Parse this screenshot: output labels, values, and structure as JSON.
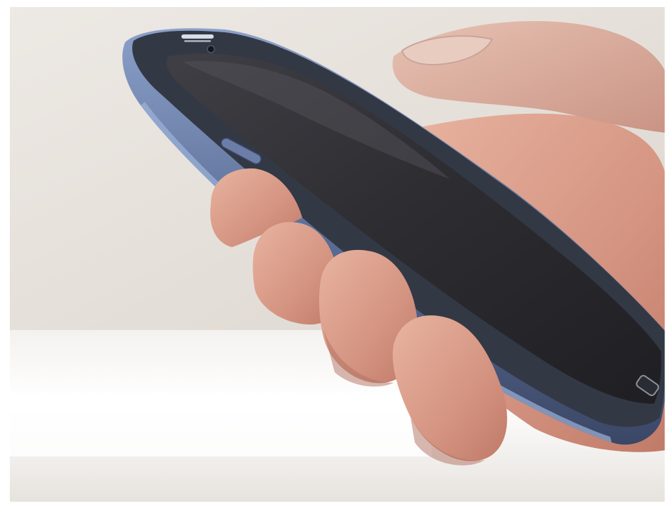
{
  "scene": {
    "subject": "photo",
    "colors": {
      "wall": "#e9e4df",
      "floor": "#ece8e3",
      "skin": "#d89a86",
      "skin_shadow": "#b36f5e",
      "phone_bezel": "#5a6a90",
      "phone_body": "#3a4560",
      "screen": "#2c2c31",
      "screen_reflection": "#4b4a52"
    },
    "icons": [
      "power-button-icon",
      "home-button-icon",
      "speaker-grille-icon",
      "front-camera-icon"
    ]
  }
}
